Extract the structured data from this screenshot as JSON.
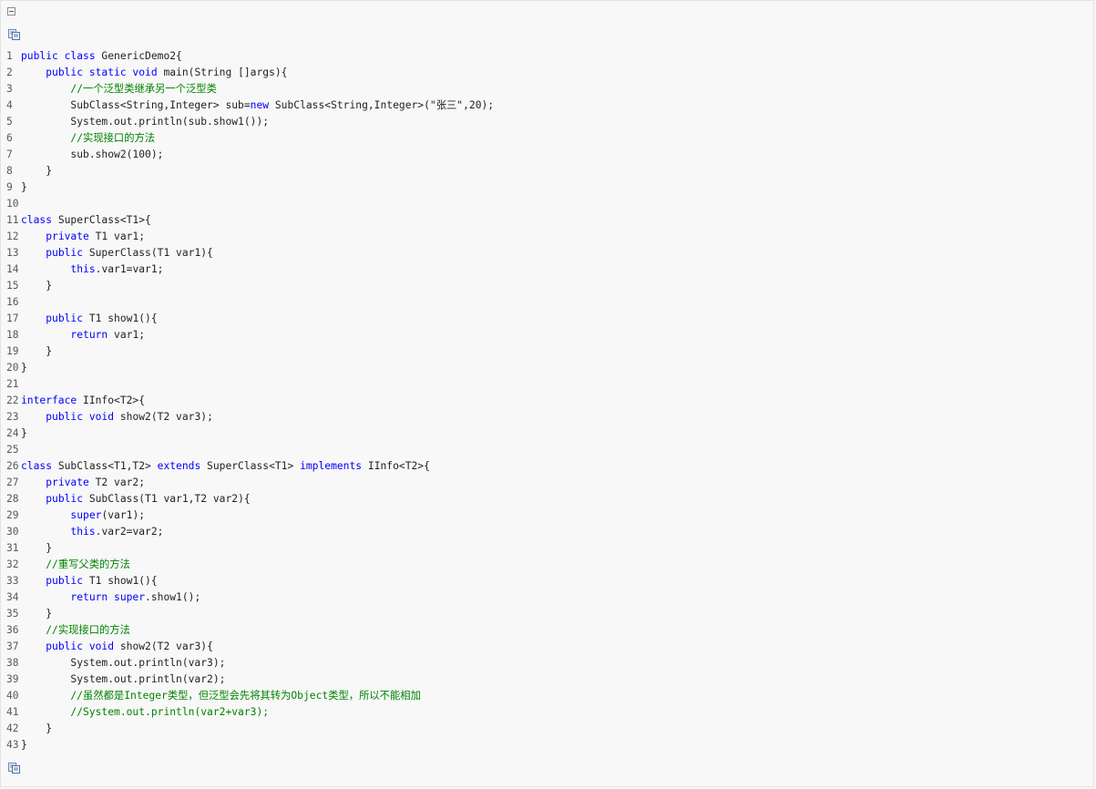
{
  "toolbar": {
    "collapse_icon": "minus-box-icon",
    "copy_icon": "copy-code-icon"
  },
  "colors": {
    "keyword": "#0000ff",
    "comment": "#008200",
    "text": "#222222",
    "line_number": "#5a5a5a",
    "background": "#f8f8f8"
  },
  "code_lines": [
    {
      "n": "1",
      "tokens": [
        {
          "t": "public class",
          "k": "kw"
        },
        {
          "t": " GenericDemo2{"
        }
      ]
    },
    {
      "n": "2",
      "tokens": [
        {
          "t": "    "
        },
        {
          "t": "public static void",
          "k": "kw"
        },
        {
          "t": " main(String []args){"
        }
      ]
    },
    {
      "n": "3",
      "tokens": [
        {
          "t": "        "
        },
        {
          "t": "//一个泛型类继承另一个泛型类",
          "k": "cm"
        }
      ]
    },
    {
      "n": "4",
      "tokens": [
        {
          "t": "        SubClass<String,Integer> sub="
        },
        {
          "t": "new",
          "k": "kw"
        },
        {
          "t": " SubClass<String,Integer>(\"张三\",20);"
        }
      ]
    },
    {
      "n": "5",
      "tokens": [
        {
          "t": "        System.out.println(sub.show1());"
        }
      ]
    },
    {
      "n": "6",
      "tokens": [
        {
          "t": "        "
        },
        {
          "t": "//实现接口的方法",
          "k": "cm"
        }
      ]
    },
    {
      "n": "7",
      "tokens": [
        {
          "t": "        sub.show2(100);"
        }
      ]
    },
    {
      "n": "8",
      "tokens": [
        {
          "t": "    }"
        }
      ]
    },
    {
      "n": "9",
      "tokens": [
        {
          "t": "}"
        }
      ]
    },
    {
      "n": "10",
      "tokens": []
    },
    {
      "n": "11",
      "tokens": [
        {
          "t": "class",
          "k": "kw"
        },
        {
          "t": " SuperClass<T1>{"
        }
      ]
    },
    {
      "n": "12",
      "tokens": [
        {
          "t": "    "
        },
        {
          "t": "private",
          "k": "kw"
        },
        {
          "t": " T1 var1;"
        }
      ]
    },
    {
      "n": "13",
      "tokens": [
        {
          "t": "    "
        },
        {
          "t": "public",
          "k": "kw"
        },
        {
          "t": " SuperClass(T1 var1){"
        }
      ]
    },
    {
      "n": "14",
      "tokens": [
        {
          "t": "        "
        },
        {
          "t": "this",
          "k": "kw"
        },
        {
          "t": ".var1=var1;"
        }
      ]
    },
    {
      "n": "15",
      "tokens": [
        {
          "t": "    }"
        }
      ]
    },
    {
      "n": "16",
      "tokens": []
    },
    {
      "n": "17",
      "tokens": [
        {
          "t": "    "
        },
        {
          "t": "public",
          "k": "kw"
        },
        {
          "t": " T1 show1(){"
        }
      ]
    },
    {
      "n": "18",
      "tokens": [
        {
          "t": "        "
        },
        {
          "t": "return",
          "k": "kw"
        },
        {
          "t": " var1;"
        }
      ]
    },
    {
      "n": "19",
      "tokens": [
        {
          "t": "    }"
        }
      ]
    },
    {
      "n": "20",
      "tokens": [
        {
          "t": "}"
        }
      ]
    },
    {
      "n": "21",
      "tokens": []
    },
    {
      "n": "22",
      "tokens": [
        {
          "t": "interface",
          "k": "kw"
        },
        {
          "t": " IInfo<T2>{"
        }
      ]
    },
    {
      "n": "23",
      "tokens": [
        {
          "t": "    "
        },
        {
          "t": "public void",
          "k": "kw"
        },
        {
          "t": " show2(T2 var3);"
        }
      ]
    },
    {
      "n": "24",
      "tokens": [
        {
          "t": "}"
        }
      ]
    },
    {
      "n": "25",
      "tokens": []
    },
    {
      "n": "26",
      "tokens": [
        {
          "t": "class",
          "k": "kw"
        },
        {
          "t": " SubClass<T1,T2> "
        },
        {
          "t": "extends",
          "k": "kw"
        },
        {
          "t": " SuperClass<T1> "
        },
        {
          "t": "implements",
          "k": "kw"
        },
        {
          "t": " IInfo<T2>{"
        }
      ]
    },
    {
      "n": "27",
      "tokens": [
        {
          "t": "    "
        },
        {
          "t": "private",
          "k": "kw"
        },
        {
          "t": " T2 var2;"
        }
      ]
    },
    {
      "n": "28",
      "tokens": [
        {
          "t": "    "
        },
        {
          "t": "public",
          "k": "kw"
        },
        {
          "t": " SubClass(T1 var1,T2 var2){"
        }
      ]
    },
    {
      "n": "29",
      "tokens": [
        {
          "t": "        "
        },
        {
          "t": "super",
          "k": "kw"
        },
        {
          "t": "(var1);"
        }
      ]
    },
    {
      "n": "30",
      "tokens": [
        {
          "t": "        "
        },
        {
          "t": "this",
          "k": "kw"
        },
        {
          "t": ".var2=var2;"
        }
      ]
    },
    {
      "n": "31",
      "tokens": [
        {
          "t": "    }"
        }
      ]
    },
    {
      "n": "32",
      "tokens": [
        {
          "t": "    "
        },
        {
          "t": "//重写父类的方法",
          "k": "cm"
        }
      ]
    },
    {
      "n": "33",
      "tokens": [
        {
          "t": "    "
        },
        {
          "t": "public",
          "k": "kw"
        },
        {
          "t": " T1 show1(){"
        }
      ]
    },
    {
      "n": "34",
      "tokens": [
        {
          "t": "        "
        },
        {
          "t": "return super",
          "k": "kw"
        },
        {
          "t": ".show1();"
        }
      ]
    },
    {
      "n": "35",
      "tokens": [
        {
          "t": "    }"
        }
      ]
    },
    {
      "n": "36",
      "tokens": [
        {
          "t": "    "
        },
        {
          "t": "//实现接口的方法",
          "k": "cm"
        }
      ]
    },
    {
      "n": "37",
      "tokens": [
        {
          "t": "    "
        },
        {
          "t": "public void",
          "k": "kw"
        },
        {
          "t": " show2(T2 var3){"
        }
      ]
    },
    {
      "n": "38",
      "tokens": [
        {
          "t": "        System.out.println(var3);"
        }
      ]
    },
    {
      "n": "39",
      "tokens": [
        {
          "t": "        System.out.println(var2);"
        }
      ]
    },
    {
      "n": "40",
      "tokens": [
        {
          "t": "        "
        },
        {
          "t": "//虽然都是Integer类型，但泛型会先将其转为Object类型，所以不能相加",
          "k": "cm"
        }
      ]
    },
    {
      "n": "41",
      "tokens": [
        {
          "t": "        "
        },
        {
          "t": "//System.out.println(var2+var3);",
          "k": "cm"
        }
      ]
    },
    {
      "n": "42",
      "tokens": [
        {
          "t": "    }"
        }
      ]
    },
    {
      "n": "43",
      "tokens": [
        {
          "t": "}"
        }
      ]
    }
  ]
}
